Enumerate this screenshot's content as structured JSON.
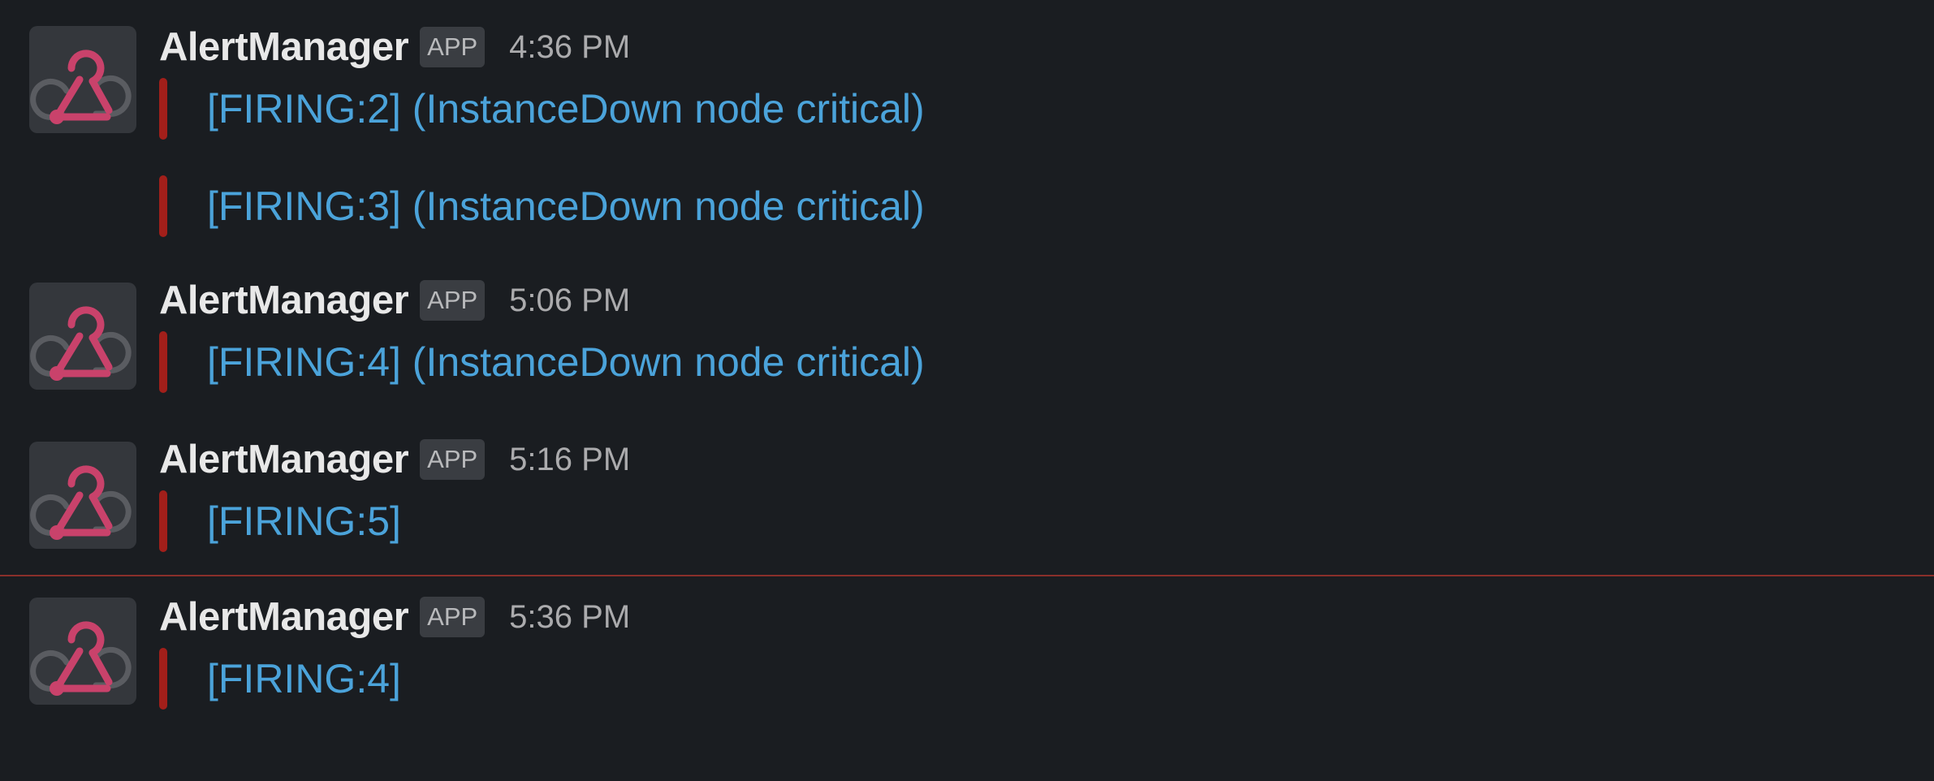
{
  "messages": [
    {
      "sender": "AlertManager",
      "badge": "APP",
      "time": "4:36 PM",
      "attachments": [
        {
          "text": "[FIRING:2]  (InstanceDown node critical)"
        },
        {
          "text": "[FIRING:3]  (InstanceDown node critical)"
        }
      ]
    },
    {
      "sender": "AlertManager",
      "badge": "APP",
      "time": "5:06 PM",
      "attachments": [
        {
          "text": "[FIRING:4]  (InstanceDown node critical)"
        }
      ]
    },
    {
      "sender": "AlertManager",
      "badge": "APP",
      "time": "5:16 PM",
      "attachments": [
        {
          "text": "[FIRING:5]"
        }
      ]
    },
    {
      "sender": "AlertManager",
      "badge": "APP",
      "time": "5:36 PM",
      "attachments": [
        {
          "text": "[FIRING:4]"
        }
      ]
    }
  ],
  "colors": {
    "background": "#1a1d21",
    "link": "#4ba3da",
    "attachment_bar": "#a21f1a",
    "new_divider": "#8a2f2a",
    "avatar_logo": "#c9426b"
  },
  "icons": {
    "avatar": "webhook-icon"
  }
}
